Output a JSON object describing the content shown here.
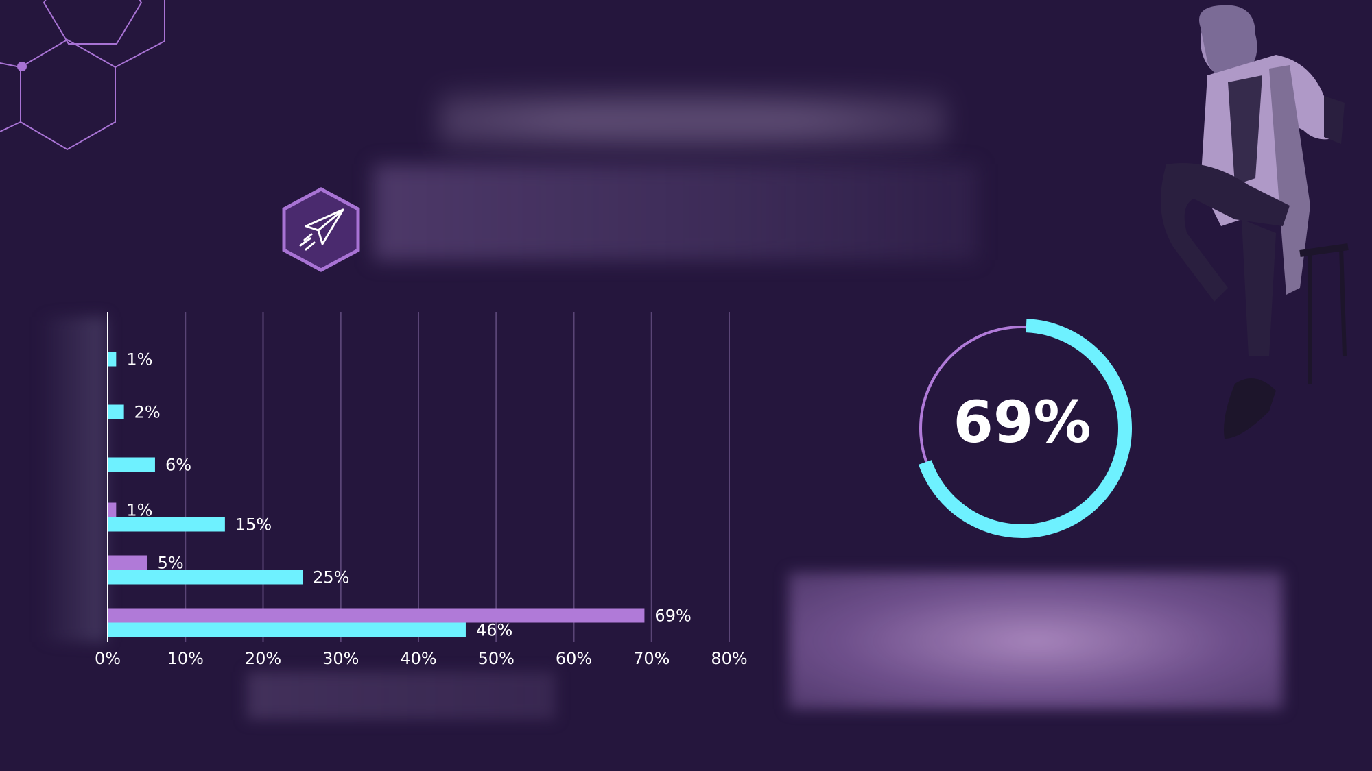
{
  "chart_data": {
    "type": "bar",
    "orientation": "horizontal",
    "categories": [
      "",
      "",
      "",
      "",
      "",
      ""
    ],
    "series": [
      {
        "color": "#b07ad8",
        "values": [
          0,
          0,
          0,
          1,
          5,
          69
        ]
      },
      {
        "color": "#6ef1ff",
        "values": [
          1,
          2,
          6,
          15,
          25,
          46
        ]
      }
    ],
    "data_labels": {
      "purple": [
        "",
        "",
        "",
        "1%",
        "5%",
        "69%"
      ],
      "cyan": [
        "1%",
        "2%",
        "6%",
        "15%",
        "25%",
        "46%"
      ]
    },
    "x_ticks": [
      "0%",
      "10%",
      "20%",
      "30%",
      "40%",
      "50%",
      "60%",
      "70%",
      "80%"
    ],
    "xlim": [
      0,
      80
    ],
    "grid": true
  },
  "donut": {
    "label": "69%",
    "value": 69,
    "fill_color": "#6ef1ff",
    "track_color": "#b07ad8"
  },
  "colors": {
    "background": "#25163d",
    "accent_purple": "#b07ad8",
    "accent_cyan": "#6ef1ff"
  },
  "icons": {
    "badge": "paper-plane-icon"
  }
}
